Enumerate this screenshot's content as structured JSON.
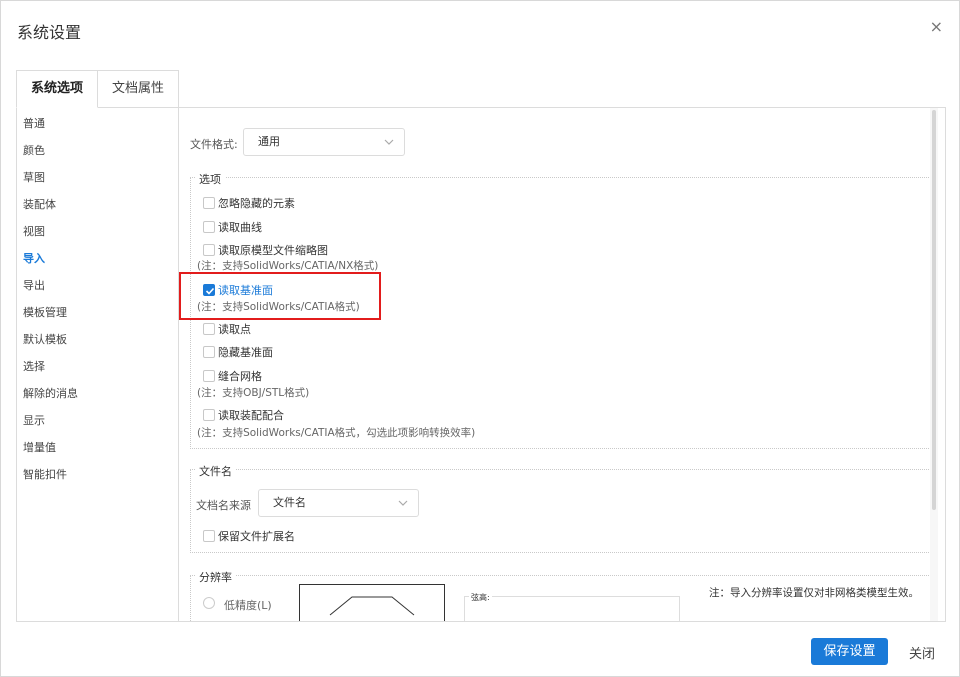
{
  "dialog": {
    "title": "系统设置",
    "close_icon": "×"
  },
  "tabs": [
    {
      "label": "系统选项",
      "active": true
    },
    {
      "label": "文档属性",
      "active": false
    }
  ],
  "sidebar": {
    "items": [
      {
        "label": "普通"
      },
      {
        "label": "颜色"
      },
      {
        "label": "草图"
      },
      {
        "label": "装配体"
      },
      {
        "label": "视图"
      },
      {
        "label": "导入",
        "active": true
      },
      {
        "label": "导出"
      },
      {
        "label": "模板管理"
      },
      {
        "label": "默认模板"
      },
      {
        "label": "选择"
      },
      {
        "label": "解除的消息"
      },
      {
        "label": "显示"
      },
      {
        "label": "增量值"
      },
      {
        "label": "智能扣件"
      }
    ]
  },
  "file_format": {
    "label": "文件格式:",
    "value": "通用"
  },
  "options": {
    "legend": "选项",
    "ignore_hidden": "忽略隐藏的元素",
    "read_curves": "读取曲线",
    "read_thumbnail": "读取原模型文件缩略图",
    "read_thumbnail_note": "(注：支持SolidWorks/CATIA/NX格式)",
    "read_datum": "读取基准面",
    "read_datum_note": "(注：支持SolidWorks/CATIA格式)",
    "read_points": "读取点",
    "hide_datum": "隐藏基准面",
    "stitch_mesh": "缝合网格",
    "stitch_mesh_note": "(注：支持OBJ/STL格式)",
    "read_mates": "读取装配配合",
    "read_mates_note": "(注：支持SolidWorks/CATIA格式，勾选此项影响转换效率)"
  },
  "filename": {
    "legend": "文件名",
    "source_label": "文档名来源",
    "source_value": "文件名",
    "keep_ext": "保留文件扩展名"
  },
  "resolution": {
    "legend": "分辨率",
    "low_label": "低精度(L)",
    "chord_label": "弦高:",
    "note": "注：导入分辨率设置仅对非网格类模型生效。"
  },
  "footer": {
    "save": "保存设置",
    "close": "关闭"
  },
  "colors": {
    "accent": "#1a7ad8",
    "highlight": "#e21c1c"
  }
}
